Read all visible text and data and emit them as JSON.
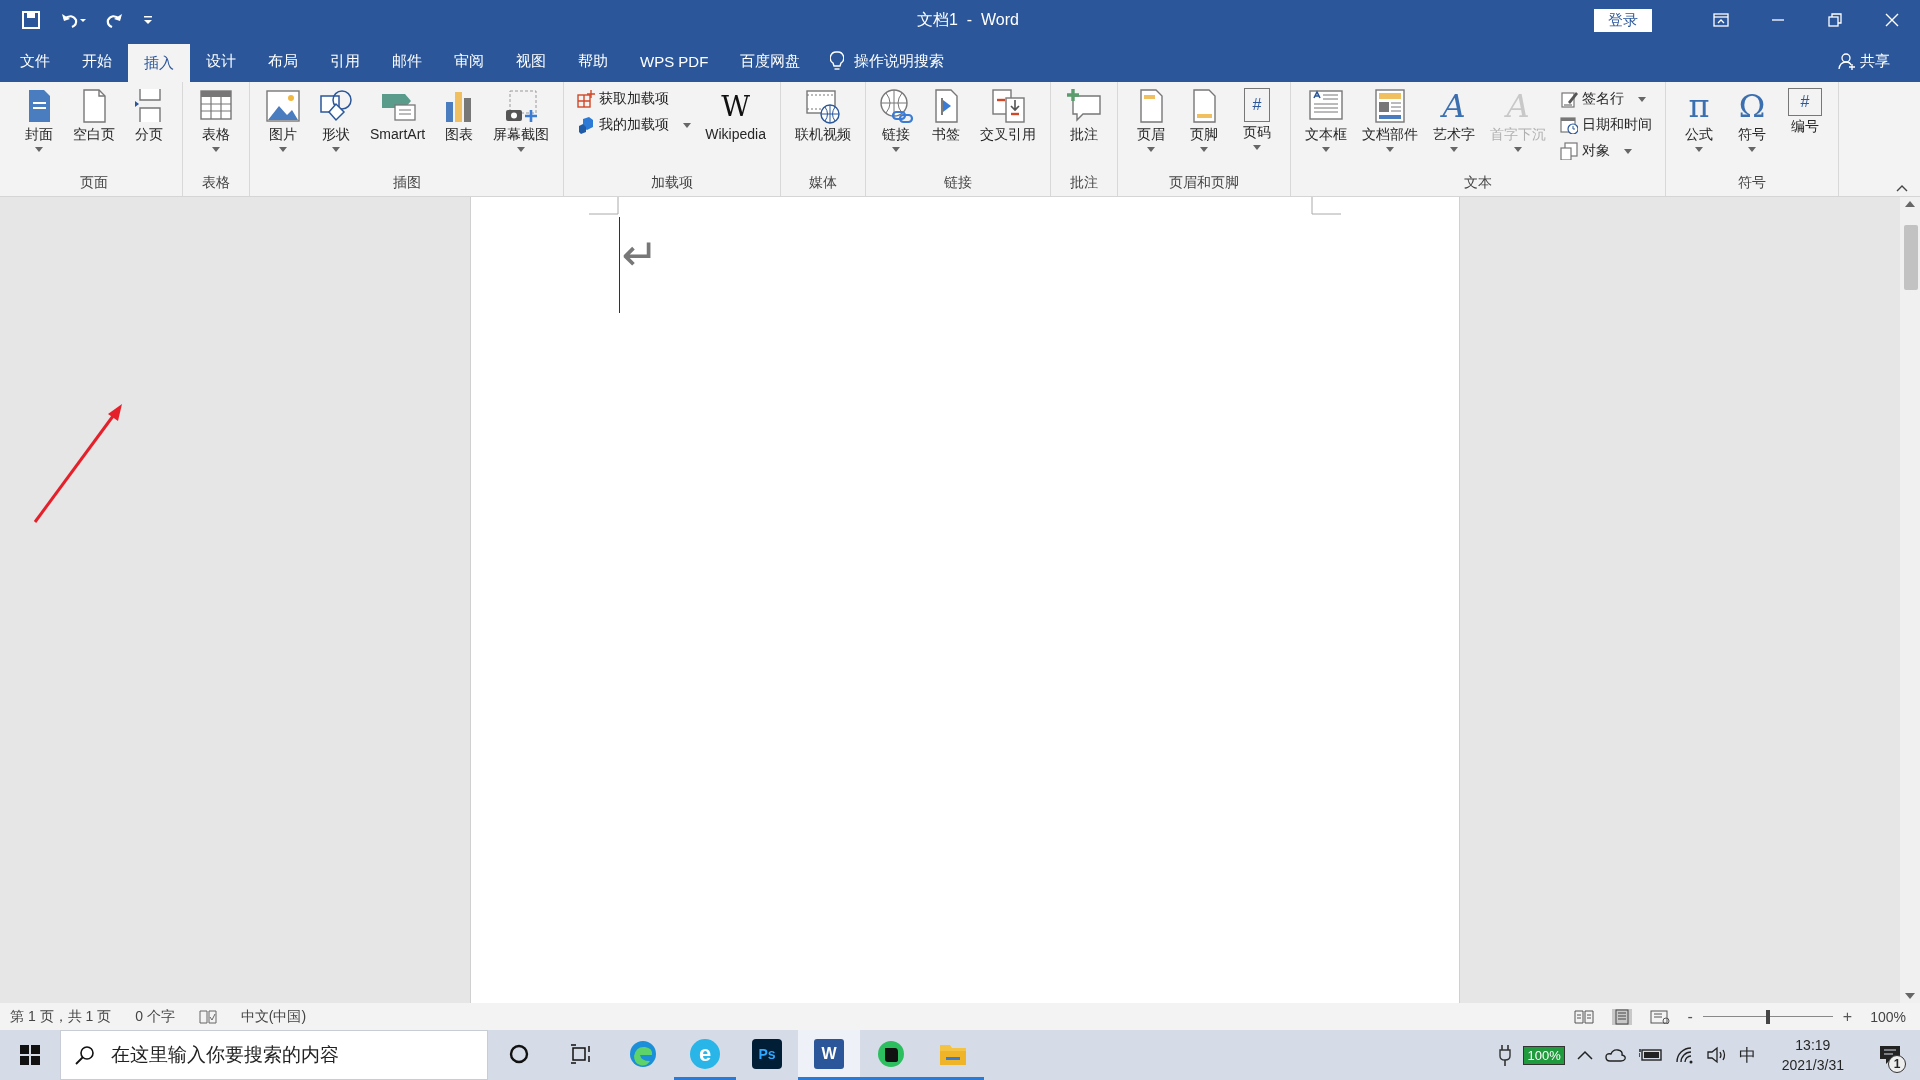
{
  "title_bar": {
    "title": "文档1  -  Word",
    "login_button": "登录"
  },
  "tabs": [
    {
      "label": "文件",
      "selected": false
    },
    {
      "label": "开始",
      "selected": false
    },
    {
      "label": "插入",
      "selected": true
    },
    {
      "label": "设计",
      "selected": false
    },
    {
      "label": "布局",
      "selected": false
    },
    {
      "label": "引用",
      "selected": false
    },
    {
      "label": "邮件",
      "selected": false
    },
    {
      "label": "审阅",
      "selected": false
    },
    {
      "label": "视图",
      "selected": false
    },
    {
      "label": "帮助",
      "selected": false
    },
    {
      "label": "WPS PDF",
      "selected": false
    },
    {
      "label": "百度网盘",
      "selected": false
    }
  ],
  "tell_me": "操作说明搜索",
  "share_button": "共享",
  "ribbon_groups": [
    {
      "label": "页面",
      "items": [
        {
          "kind": "large",
          "label": "封面",
          "dropdown": true
        },
        {
          "kind": "large",
          "label": "空白页",
          "dropdown": false
        },
        {
          "kind": "large",
          "label": "分页",
          "dropdown": false
        }
      ]
    },
    {
      "label": "表格",
      "items": [
        {
          "kind": "large",
          "label": "表格",
          "dropdown": true
        }
      ]
    },
    {
      "label": "插图",
      "items": [
        {
          "kind": "large",
          "label": "图片",
          "dropdown": true
        },
        {
          "kind": "large",
          "label": "形状",
          "dropdown": true
        },
        {
          "kind": "large",
          "label": "SmartArt",
          "dropdown": false
        },
        {
          "kind": "large",
          "label": "图表",
          "dropdown": false
        },
        {
          "kind": "large",
          "label": "屏幕截图",
          "dropdown": true
        }
      ]
    },
    {
      "label": "加载项",
      "items": [
        {
          "kind": "stack",
          "items": [
            {
              "label": "获取加载项",
              "dropdown": false
            },
            {
              "label": "我的加载项",
              "dropdown": true
            }
          ]
        },
        {
          "kind": "large",
          "label": "Wikipedia",
          "dropdown": false,
          "glyph": "W"
        }
      ]
    },
    {
      "label": "媒体",
      "items": [
        {
          "kind": "large",
          "label": "联机视频",
          "dropdown": false
        }
      ]
    },
    {
      "label": "链接",
      "items": [
        {
          "kind": "large",
          "label": "链接",
          "dropdown": true,
          "narrow": true
        },
        {
          "kind": "large",
          "label": "书签",
          "dropdown": false
        },
        {
          "kind": "large",
          "label": "交叉引用",
          "dropdown": false
        }
      ]
    },
    {
      "label": "批注",
      "items": [
        {
          "kind": "large",
          "label": "批注",
          "dropdown": false
        }
      ]
    },
    {
      "label": "页眉和页脚",
      "items": [
        {
          "kind": "large",
          "label": "页眉",
          "dropdown": true
        },
        {
          "kind": "large",
          "label": "页脚",
          "dropdown": true
        },
        {
          "kind": "large",
          "label": "页码",
          "dropdown": true,
          "glyph": "#"
        }
      ]
    },
    {
      "label": "文本",
      "items": [
        {
          "kind": "large",
          "label": "文本框",
          "dropdown": true
        },
        {
          "kind": "large",
          "label": "文档部件",
          "dropdown": true
        },
        {
          "kind": "large",
          "label": "艺术字",
          "dropdown": true,
          "glyph": "A"
        },
        {
          "kind": "large",
          "label": "首字下沉",
          "dropdown": true,
          "disabled": true,
          "glyph": "A"
        },
        {
          "kind": "stack",
          "items": [
            {
              "label": "签名行",
              "dropdown": true
            },
            {
              "label": "日期和时间",
              "dropdown": false
            },
            {
              "label": "对象",
              "dropdown": true
            }
          ]
        }
      ]
    },
    {
      "label": "符号",
      "items": [
        {
          "kind": "large",
          "label": "公式",
          "dropdown": true,
          "glyph": "π"
        },
        {
          "kind": "large",
          "label": "符号",
          "dropdown": true,
          "glyph": "Ω"
        },
        {
          "kind": "large",
          "label": "编号",
          "dropdown": false,
          "glyph": "#"
        }
      ]
    }
  ],
  "document": {
    "paragraph_mark": "↵"
  },
  "status_bar": {
    "page": "第 1 页，共 1 页",
    "word_count": "0 个字",
    "language": "中文(中国)",
    "zoom_out": "-",
    "zoom_in": "+",
    "zoom": {
      "level": 0.5
    },
    "zoom_percent": "100%"
  },
  "taskbar": {
    "search_placeholder": "在这里输入你要搜索的内容",
    "apps": [
      {
        "kind": "edge",
        "running": false,
        "active": false
      },
      {
        "kind": "browser",
        "running": true,
        "active": false,
        "glyph": "e"
      },
      {
        "kind": "photoshop",
        "running": false,
        "active": false,
        "glyph": "Ps"
      },
      {
        "kind": "word",
        "running": true,
        "active": true,
        "glyph": "W"
      },
      {
        "kind": "evernote",
        "running": true,
        "active": false
      },
      {
        "kind": "explorer",
        "running": true,
        "active": false
      }
    ],
    "battery": "100%",
    "input_method": "中",
    "time": "13:19",
    "date": "2021/3/31",
    "notification_count": "1"
  }
}
